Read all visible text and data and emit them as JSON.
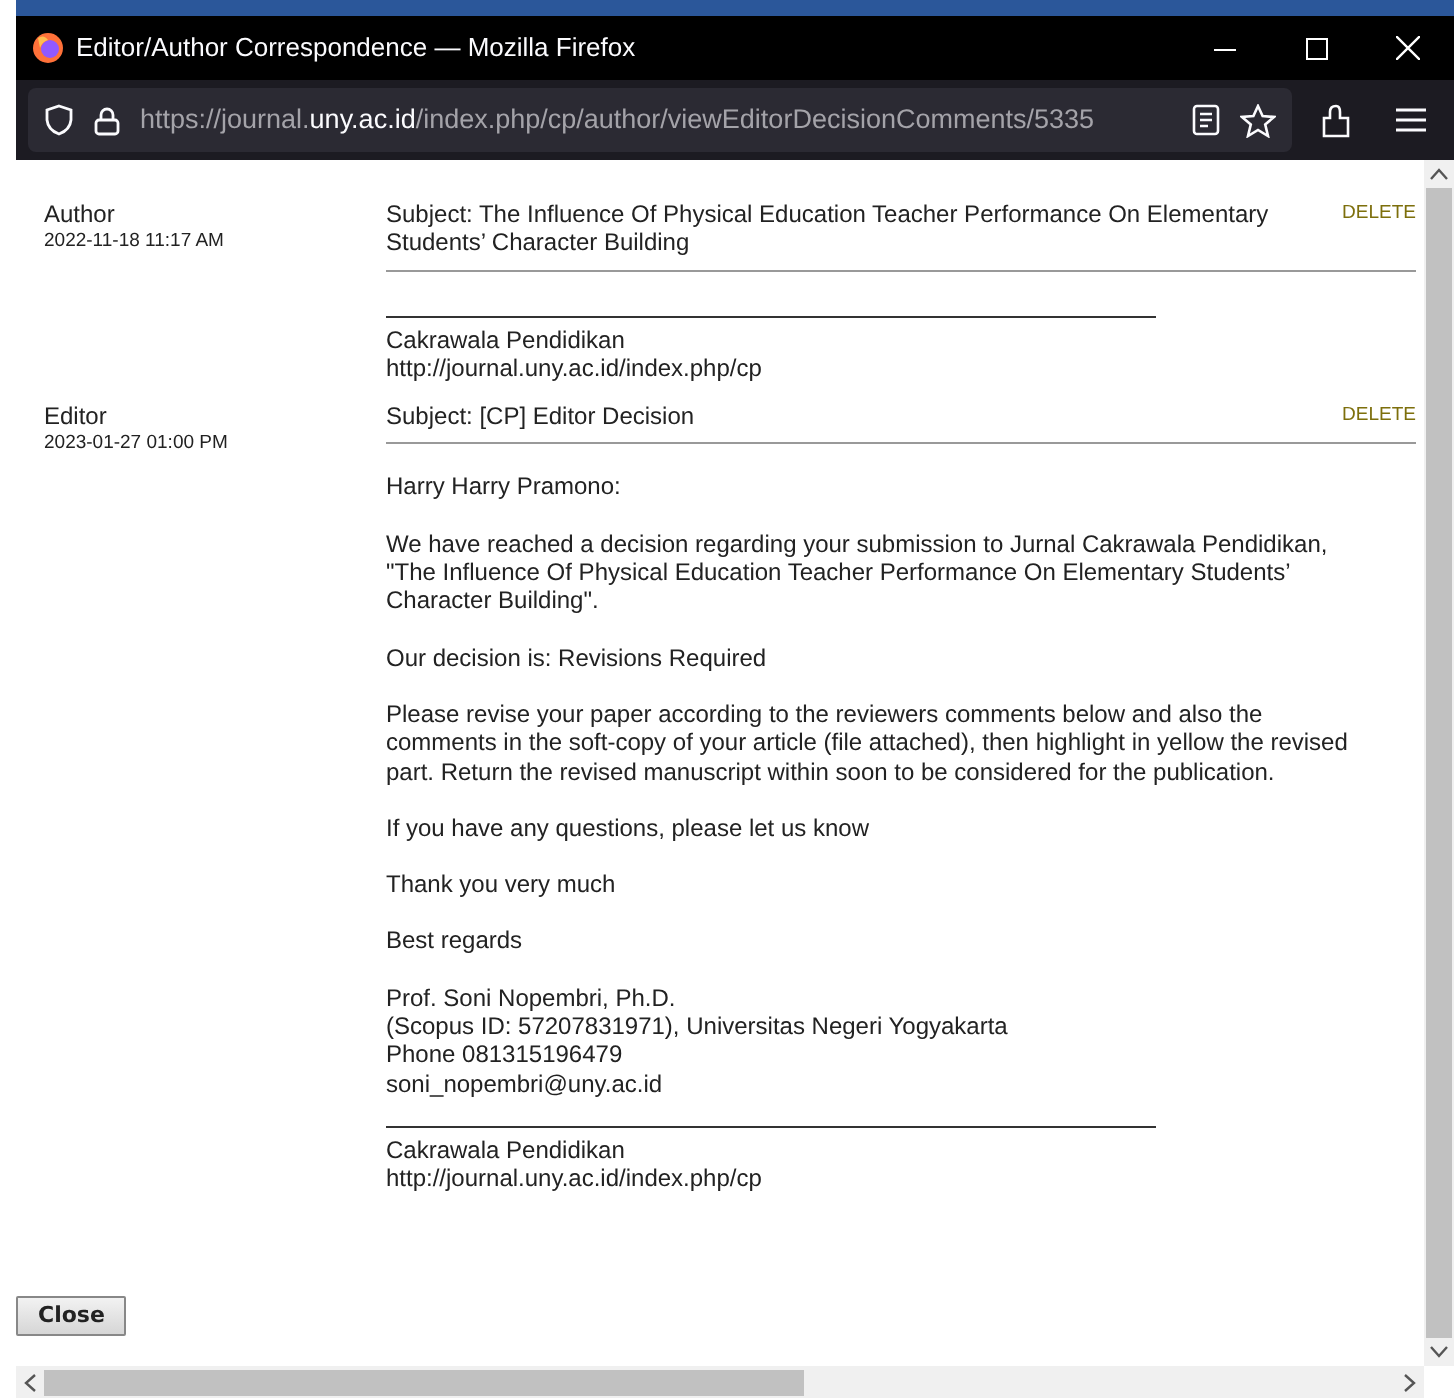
{
  "window": {
    "title": "Editor/Author Correspondence — Mozilla Firefox"
  },
  "address_bar": {
    "url_parts": [
      {
        "text": "https://journal.",
        "emphasis": false
      },
      {
        "text": "uny.ac.id",
        "emphasis": true
      },
      {
        "text": "/index.php/cp/author/viewEditorDecisionComments/5335",
        "emphasis": false
      }
    ]
  },
  "comments": [
    {
      "role": "Author",
      "date": "2022-11-18 11:17 AM",
      "subject": "Subject: The Influence Of Physical Education Teacher Performance On Elementary Students’ Character Building",
      "delete_label": "DELETE",
      "signature": [
        "Cakrawala Pendidikan",
        "http://journal.uny.ac.id/index.php/cp"
      ]
    },
    {
      "role": "Editor",
      "date": "2023-01-27 01:00 PM",
      "subject": "Subject: [CP] Editor Decision",
      "delete_label": "DELETE",
      "paragraphs": [
        [
          "Harry Harry Pramono:"
        ],
        [
          "We have reached a decision regarding your submission to Jurnal Cakrawala Pendidikan, \"The Influence Of Physical Education Teacher Performance On Elementary Students’ Character Building\"."
        ],
        [
          "Our decision is: Revisions Required"
        ],
        [
          "Please revise your paper according to the reviewers comments below and also the comments in the soft-copy of your article (file attached), then highlight in yellow the revised part. Return the revised manuscript within soon to be considered for the publication."
        ],
        [
          "If you have any questions, please let us know"
        ],
        [
          "Thank you very much"
        ],
        [
          "Best regards"
        ],
        [
          "Prof. Soni Nopembri, Ph.D.",
          "(Scopus ID: 57207831971), Universitas Negeri Yogyakarta",
          "Phone 081315196479",
          "soni_nopembri@uny.ac.id"
        ]
      ],
      "signature": [
        "Cakrawala Pendidikan",
        "http://journal.uny.ac.id/index.php/cp"
      ]
    }
  ],
  "close_button": {
    "label": "Close"
  }
}
